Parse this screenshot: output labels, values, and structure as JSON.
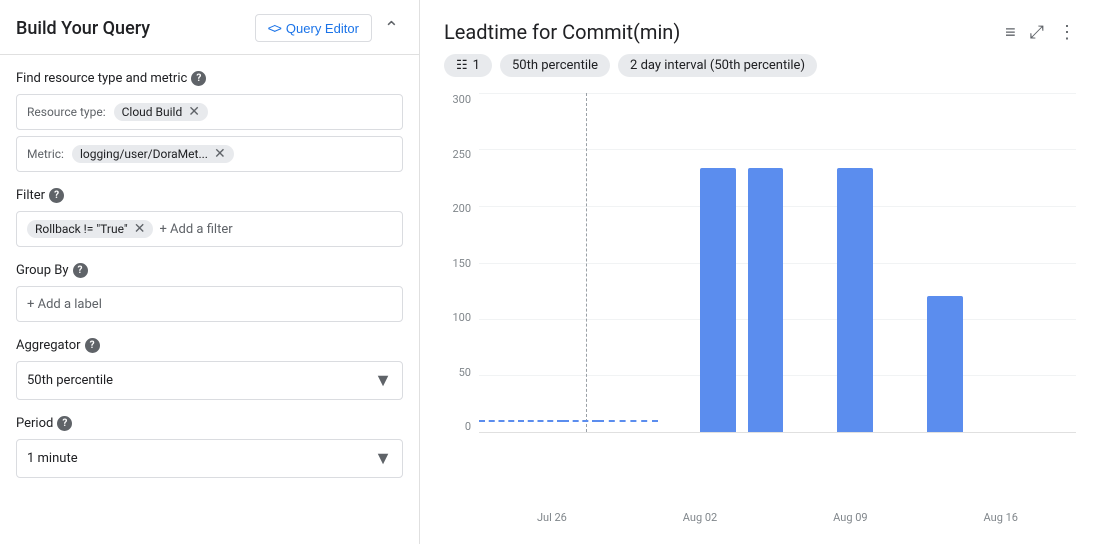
{
  "leftPanel": {
    "title": "Build Your Query",
    "queryEditorLabel": "Query Editor",
    "collapseLabel": "^",
    "sections": {
      "resourceMetric": {
        "label": "Find resource type and metric",
        "resourceTypeLabel": "Resource type:",
        "resourceTypeChip": "Cloud Build",
        "metricLabel": "Metric:",
        "metricChip": "logging/user/DoraMet..."
      },
      "filter": {
        "label": "Filter",
        "filterChip": "Rollback != \"True\"",
        "addFilterLabel": "+ Add a filter"
      },
      "groupBy": {
        "label": "Group By",
        "addLabelText": "+ Add a label"
      },
      "aggregator": {
        "label": "Aggregator",
        "selectedValue": "50th percentile"
      },
      "period": {
        "label": "Period",
        "selectedValue": "1 minute"
      }
    }
  },
  "chart": {
    "title": "Leadtime for Commit(min)",
    "filterChips": [
      {
        "label": "1",
        "icon": "≡"
      },
      {
        "label": "50th percentile"
      },
      {
        "label": "2 day interval (50th percentile)"
      }
    ],
    "yAxis": {
      "labels": [
        "300",
        "250",
        "200",
        "150",
        "100",
        "50",
        "0"
      ]
    },
    "xAxis": {
      "labels": [
        "Jul 26",
        "Aug 02",
        "Aug 09",
        "Aug 16"
      ]
    },
    "bars": [
      {
        "label": "bar1",
        "heightPercent": 78,
        "leftPercent": 38
      },
      {
        "label": "bar2",
        "heightPercent": 78,
        "leftPercent": 48
      },
      {
        "label": "bar3",
        "heightPercent": 78,
        "leftPercent": 63
      },
      {
        "label": "bar4",
        "heightPercent": 43,
        "leftPercent": 75
      }
    ],
    "icons": {
      "list": "≡",
      "expand": "⤢",
      "more": "⋮"
    }
  }
}
